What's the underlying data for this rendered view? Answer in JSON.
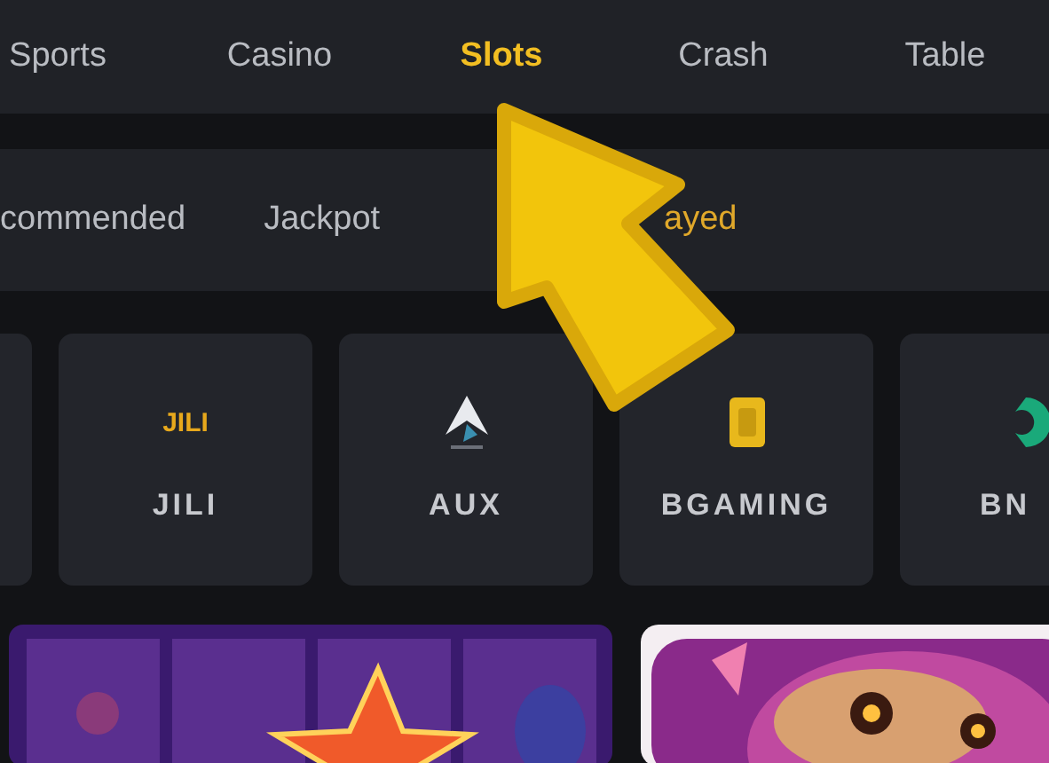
{
  "main_tabs": [
    {
      "label": "Sports",
      "selected": false
    },
    {
      "label": "Casino",
      "selected": false
    },
    {
      "label": "Slots",
      "selected": true
    },
    {
      "label": "Crash",
      "selected": false
    },
    {
      "label": "Table",
      "selected": false
    }
  ],
  "sub_tabs": [
    {
      "label": "commended",
      "selected": false
    },
    {
      "label": "Jackpot",
      "selected": false
    },
    {
      "label": "ayed",
      "selected": true
    }
  ],
  "providers": [
    {
      "kind": "empty"
    },
    {
      "kind": "jili",
      "logo_text": "JILI",
      "name": "JILI"
    },
    {
      "kind": "aux",
      "name": "AUX"
    },
    {
      "kind": "bgaming",
      "name": "BGAMING"
    },
    {
      "kind": "bng",
      "name": "BN"
    }
  ]
}
